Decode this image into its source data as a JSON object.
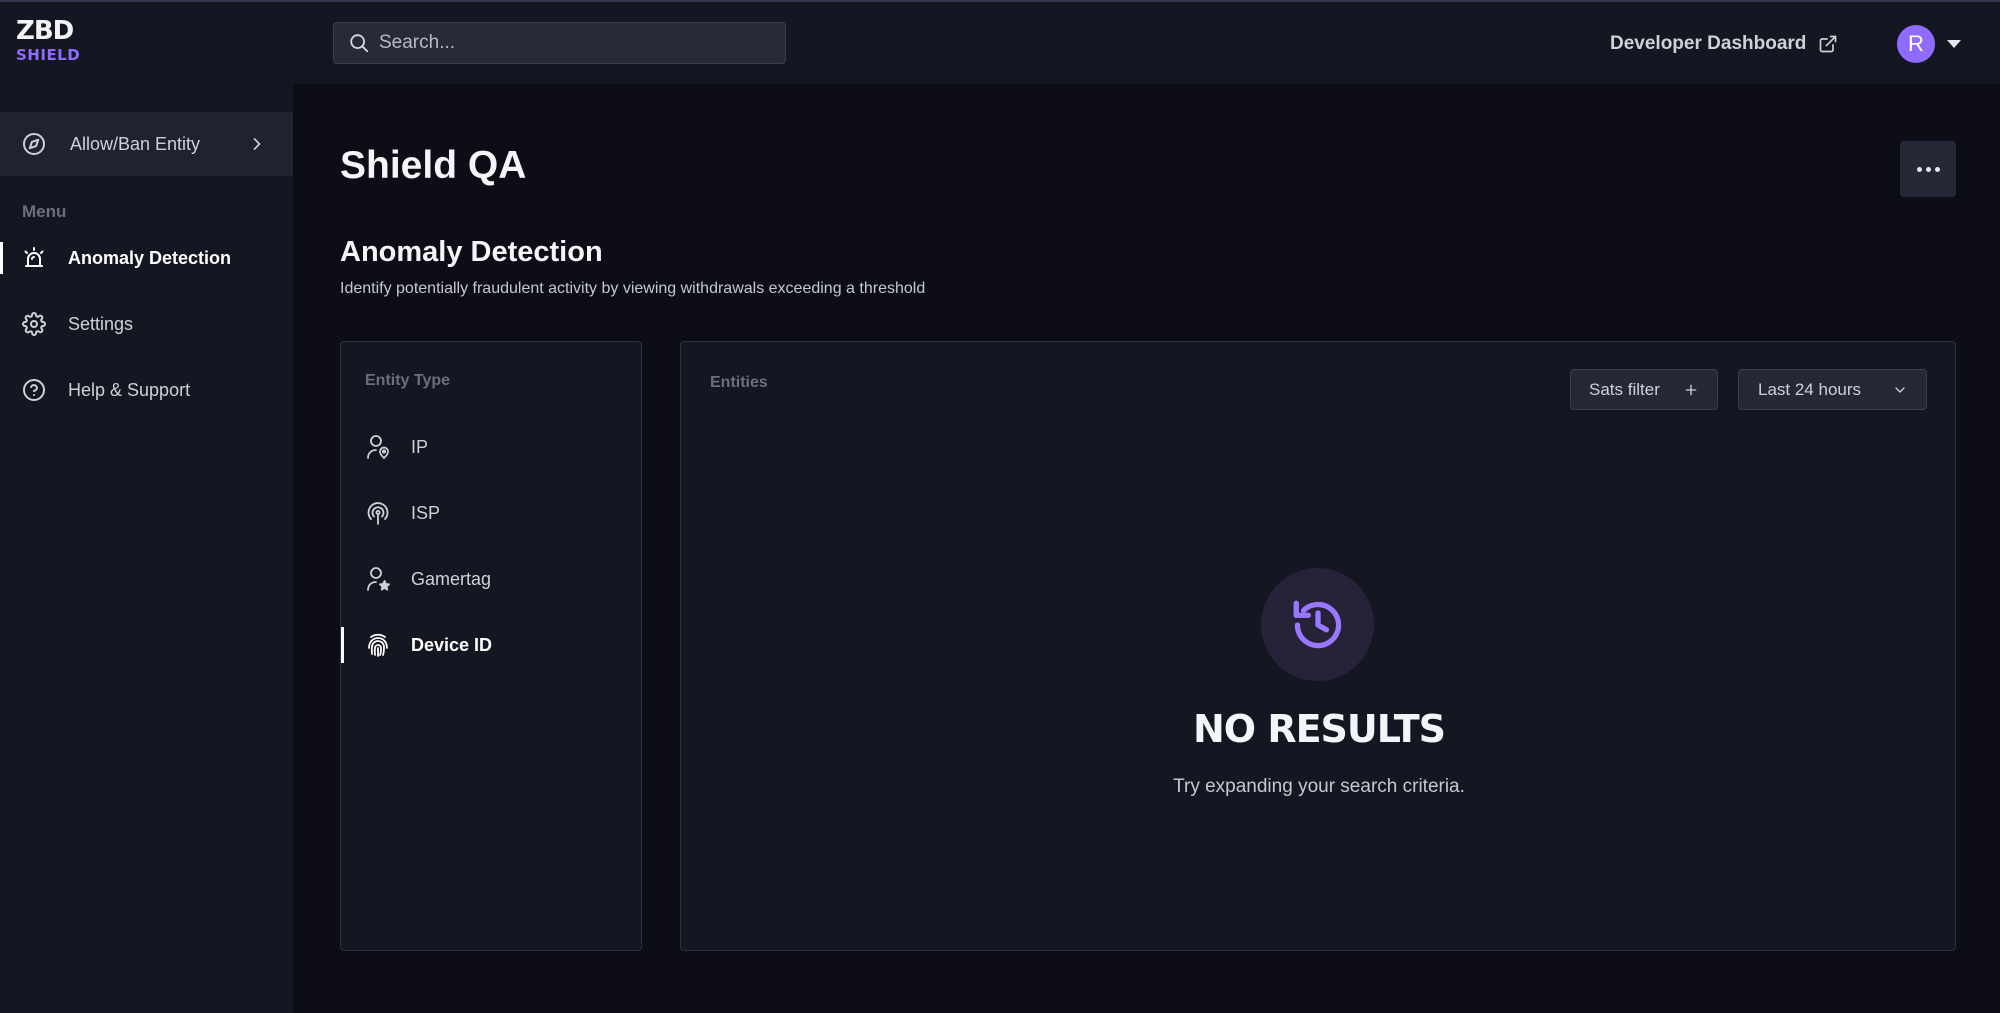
{
  "brand": {
    "logo_top": "ZBD",
    "logo_bottom": "SHIELD",
    "accent": "#8f6bff"
  },
  "header": {
    "search_placeholder": "Search...",
    "dev_dashboard_label": "Developer Dashboard",
    "avatar_initial": "R"
  },
  "sidebar": {
    "allow_ban_label": "Allow/Ban Entity",
    "menu_title": "Menu",
    "items": [
      {
        "label": "Anomaly Detection",
        "icon": "alarm-icon",
        "active": true
      },
      {
        "label": "Settings",
        "icon": "gear-icon",
        "active": false
      },
      {
        "label": "Help & Support",
        "icon": "help-circle-icon",
        "active": false
      }
    ]
  },
  "main": {
    "page_title": "Shield QA",
    "section_title": "Anomaly Detection",
    "section_description": "Identify potentially fraudulent activity by viewing withdrawals exceeding a threshold",
    "entity_panel": {
      "label": "Entity Type",
      "types": [
        {
          "label": "IP",
          "icon": "user-location-icon",
          "active": false
        },
        {
          "label": "ISP",
          "icon": "broadcast-icon",
          "active": false
        },
        {
          "label": "Gamertag",
          "icon": "user-star-icon",
          "active": false
        },
        {
          "label": "Device ID",
          "icon": "fingerprint-icon",
          "active": true
        }
      ]
    },
    "results_panel": {
      "label": "Entities",
      "sats_filter_label": "Sats filter",
      "time_range_label": "Last 24 hours",
      "empty_title": "NO RESULTS",
      "empty_description": "Try expanding your search criteria."
    }
  }
}
